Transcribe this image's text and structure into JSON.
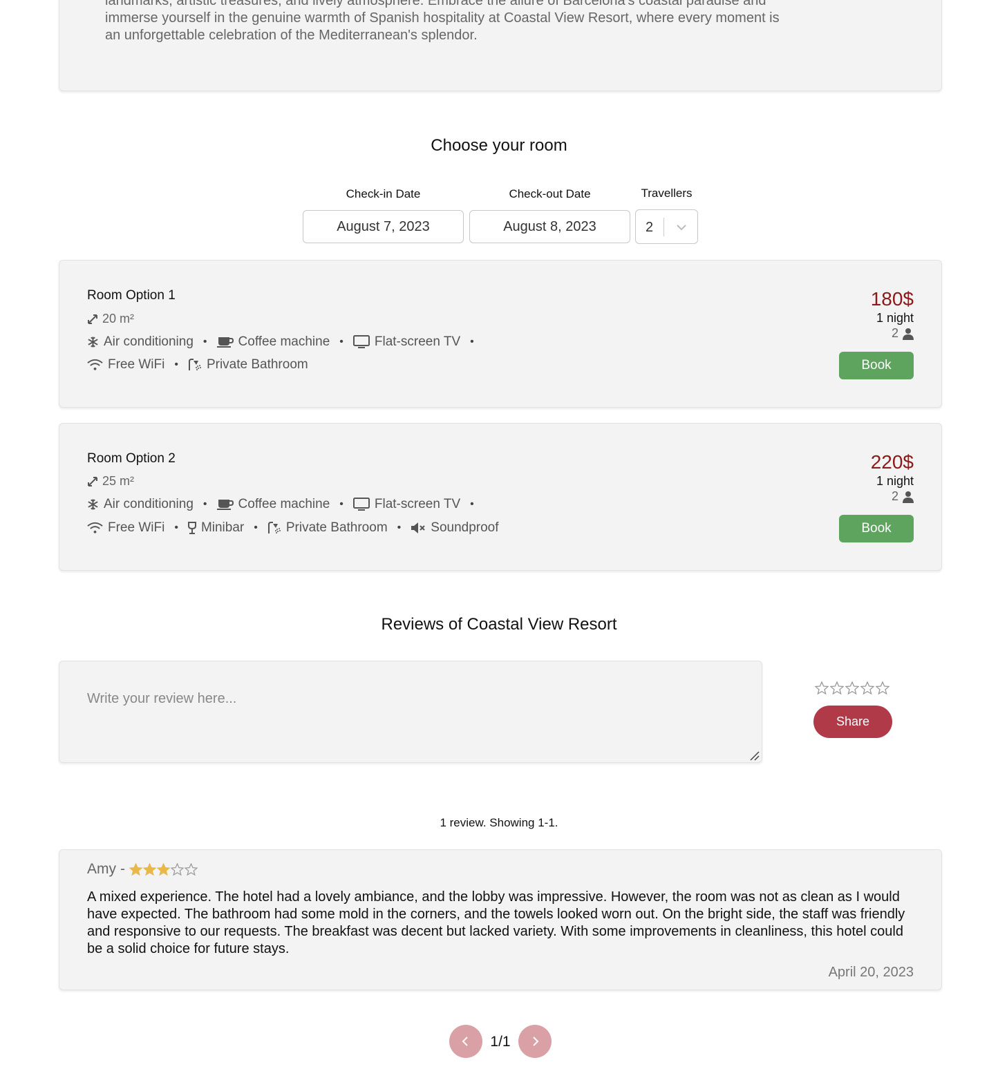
{
  "hotel": {
    "description": "landmarks, artistic treasures, and lively atmosphere. Embrace the allure of Barcelona's coastal paradise and immerse yourself in the genuine warmth of Spanish hospitality at Coastal View Resort, where every moment is an unforgettable celebration of the Mediterranean's splendor."
  },
  "booking": {
    "title": "Choose your room",
    "checkin_label": "Check-in Date",
    "checkin_value": "August 7, 2023",
    "checkout_label": "Check-out Date",
    "checkout_value": "August 8, 2023",
    "travellers_label": "Travellers",
    "travellers_value": "2"
  },
  "rooms": [
    {
      "name": "Room Option 1",
      "size": "20 m²",
      "amenities_row1": [
        "Air conditioning",
        "Coffee machine",
        "Flat-screen TV"
      ],
      "amenities_row2": [
        "Free WiFi",
        "Private Bathroom"
      ],
      "price": "180$",
      "nights": "1 night",
      "guests": "2",
      "book_label": "Book"
    },
    {
      "name": "Room Option 2",
      "size": "25 m²",
      "amenities_row1": [
        "Air conditioning",
        "Coffee machine",
        "Flat-screen TV"
      ],
      "amenities_row2": [
        "Free WiFi",
        "Minibar",
        "Private Bathroom",
        "Soundproof"
      ],
      "price": "220$",
      "nights": "1 night",
      "guests": "2",
      "book_label": "Book"
    }
  ],
  "amenity_icons": {
    "Air conditioning": "snowflake-icon",
    "Coffee machine": "coffee-icon",
    "Flat-screen TV": "tv-icon",
    "Free WiFi": "wifi-icon",
    "Minibar": "wine-glass-icon",
    "Private Bathroom": "shower-icon",
    "Soundproof": "volume-mute-icon"
  },
  "reviews": {
    "title": "Reviews of Coastal View Resort",
    "placeholder": "Write your review here...",
    "input_rating": 0,
    "share_label": "Share",
    "count_text": "1 review. Showing 1-1.",
    "items": [
      {
        "author": "Amy",
        "separator": "-",
        "rating": 3,
        "text": "A mixed experience. The hotel had a lovely ambiance, and the lobby was impressive. However, the room was not as clean as I would have expected. The bathroom had some mold in the corners, and the towels looked worn out. On the bright side, the staff was friendly and responsive to our requests. The breakfast was decent but lacked variety. With some improvements in cleanliness, this hotel could be a solid choice for future stays.",
        "date": "April 20, 2023"
      }
    ]
  },
  "pagination": {
    "label": "1/1"
  },
  "colors": {
    "price": "#8b1a1a",
    "book_button": "#5ea35e",
    "share_button": "#b13a48",
    "page_button": "#d9a0a6",
    "star_filled": "#e8b94a"
  }
}
